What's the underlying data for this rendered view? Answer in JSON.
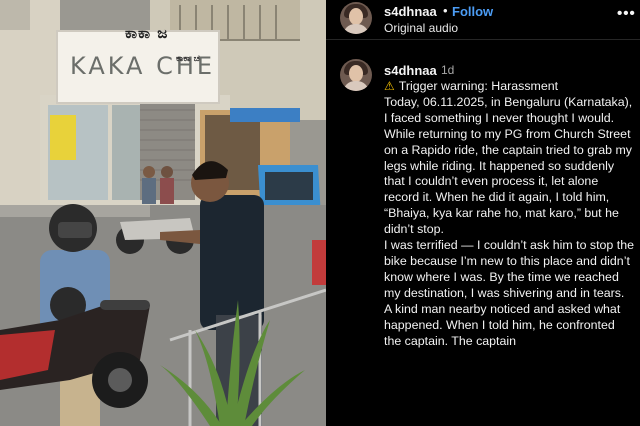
{
  "photo": {
    "sign_kannada_top": "ಕಾಕಾ ಜ",
    "sign_main": "KAKA CHE",
    "sign_kannada_small": "ಕಾಕಾ ಚ"
  },
  "post": {
    "username": "s4dhnaa",
    "separator": "•",
    "follow_label": "Follow",
    "audio_label": "Original audio",
    "more_icon": "•••"
  },
  "comment": {
    "username": "s4dhnaa",
    "time": "1d",
    "warning_icon": "warning-icon",
    "warning_glyph": "⚠",
    "lines": [
      "Trigger warning: Harassment",
      "Today, 06.11.2025, in Bengaluru (Karnataka), I faced something I never thought I would. While returning to my PG from Church Street on a Rapido ride, the captain tried to grab my legs while riding. It happened so suddenly that I couldn’t even process it, let alone record it. When he did it again, I told him, “Bhaiya, kya kar rahe ho, mat karo,” but he didn’t stop.",
      "I was terrified — I couldn’t ask him to stop the bike because I’m new to this place and didn’t know where I was. By the time we reached my destination, I was shivering and in tears. A kind man nearby noticed and asked what happened. When I told him, he confronted the captain. The captain"
    ]
  },
  "colors": {
    "follow": "#4c9df5",
    "background": "#000000",
    "warning": "#f5c000"
  }
}
